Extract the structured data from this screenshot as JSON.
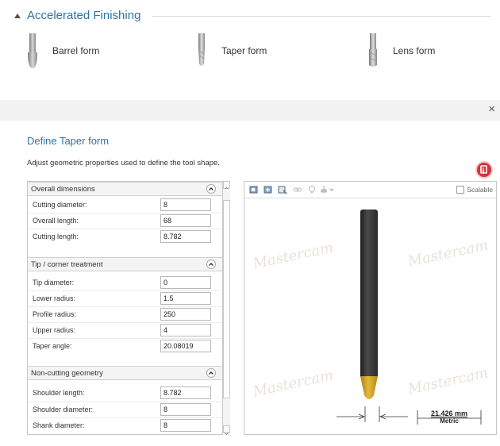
{
  "gallery": {
    "section_title": "Accelerated Finishing",
    "items": [
      {
        "label": "Barrel form",
        "icon": "barrel-form-tool-icon"
      },
      {
        "label": "Taper form",
        "icon": "taper-form-tool-icon"
      },
      {
        "label": "Lens form",
        "icon": "lens-form-tool-icon"
      }
    ]
  },
  "dialog": {
    "close_glyph": "×",
    "title": "Define Taper form",
    "description": "Adjust geometric properties used to define the tool shape.",
    "help_icon": "help-icon"
  },
  "groups": {
    "overall": {
      "title": "Overall dimensions",
      "rows": [
        {
          "label": "Cutting diameter:",
          "value": "8"
        },
        {
          "label": "Overall length:",
          "value": "68"
        },
        {
          "label": "Cutting length:",
          "value": "8.782"
        }
      ]
    },
    "tip": {
      "title": "Tip / corner treatment",
      "rows": [
        {
          "label": "Tip diameter:",
          "value": "0"
        },
        {
          "label": "Lower radius:",
          "value": "1.5"
        },
        {
          "label": "Profile radius:",
          "value": "250"
        },
        {
          "label": "Upper radius:",
          "value": "4"
        },
        {
          "label": "Taper angle:",
          "value": "20.08019"
        }
      ]
    },
    "noncutting": {
      "title": "Non-cutting geometry",
      "rows": [
        {
          "label": "Shoulder length:",
          "value": "8.782"
        },
        {
          "label": "Shoulder diameter:",
          "value": "8"
        },
        {
          "label": "Shank diameter:",
          "value": "8"
        }
      ]
    }
  },
  "preview": {
    "scalable_label": "Scalable",
    "scalable_checked": false,
    "watermark": "Mastercam",
    "dimension_value": "21.426 mm",
    "dimension_unit": "Metric",
    "colors": {
      "tool_body": "#2b2b2b",
      "tool_tip": "#c9a024",
      "accent": "#2e73a8",
      "help": "#d8313a"
    }
  }
}
